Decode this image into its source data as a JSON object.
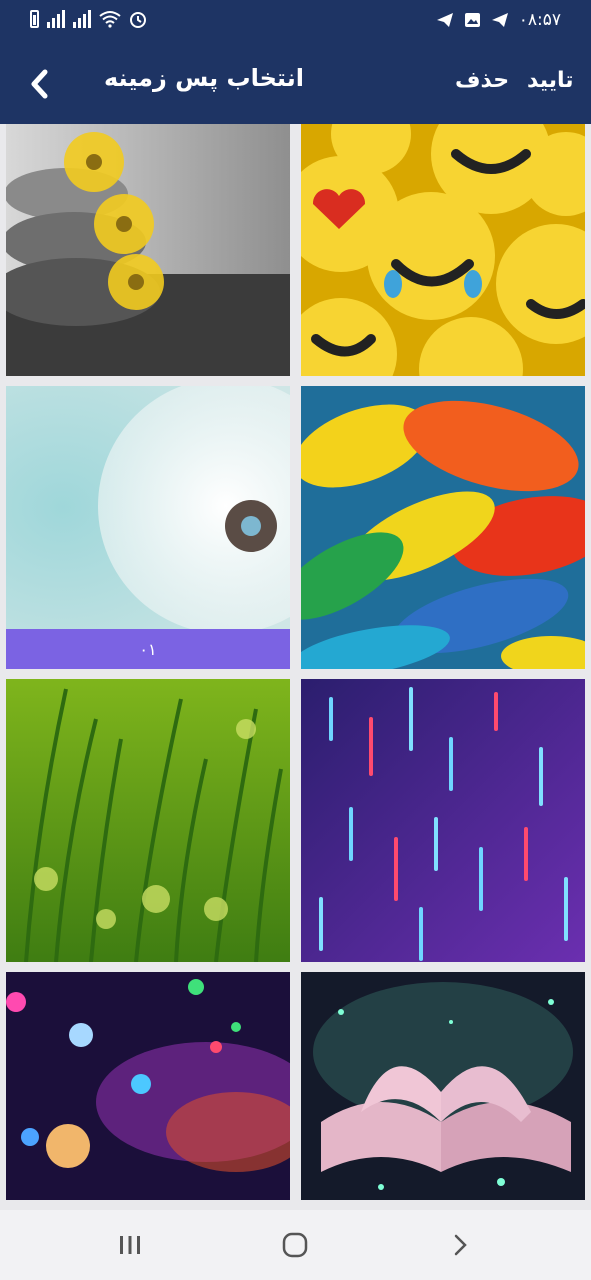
{
  "status_bar": {
    "time": "۰۸:۵۷",
    "icons": [
      "telegram-icon",
      "image-icon",
      "telegram-icon",
      "battery-icon",
      "signal-icon",
      "signal-icon",
      "wifi-icon",
      "alarm-icon"
    ]
  },
  "header": {
    "title": "انتخاب پس زمینه",
    "delete_label": "حذف",
    "confirm_label": "تایید",
    "back_icon": "chevron-left-icon",
    "background_color": "#1e3464"
  },
  "wallpapers": [
    {
      "name": "daisies-on-stones",
      "caption": ""
    },
    {
      "name": "emoji-pillows",
      "caption": ""
    },
    {
      "name": "dandelion",
      "caption": "۰۱",
      "selected": true
    },
    {
      "name": "colorful-feathers",
      "caption": ""
    },
    {
      "name": "green-grass-dew",
      "caption": ""
    },
    {
      "name": "falling-neon-rain",
      "caption": ""
    },
    {
      "name": "galaxy-bubbles",
      "caption": ""
    },
    {
      "name": "magic-book",
      "caption": ""
    }
  ],
  "selection_color": "#7b63e3",
  "nav_bar": {
    "icons": [
      "recent-apps-icon",
      "home-icon",
      "back-icon"
    ]
  }
}
